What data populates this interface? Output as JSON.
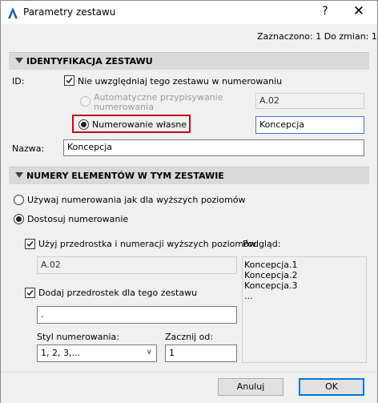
{
  "window": {
    "title": "Parametry zestawu",
    "help_label": "?",
    "close_label": "✕",
    "icon": "archicad-logo-icon"
  },
  "status": "Zaznaczono: 1 Do zmian: 1",
  "identification": {
    "header": "IDENTYFIKACJA ZESTAWU",
    "id_label": "ID:",
    "exclude_checkbox": {
      "label": "Nie uwzględniaj tego zestawu w numerowaniu",
      "checked": true
    },
    "auto_radio": {
      "label_line1": "Automatyczne przypisywanie",
      "label_line2": "numerowania",
      "checked": false,
      "enabled": false
    },
    "auto_value": "A.02",
    "custom_radio": {
      "label": "Numerowanie własne",
      "checked": true
    },
    "custom_value": "Koncepcja",
    "name_label": "Nazwa:",
    "name_value": "Koncepcja"
  },
  "numbering": {
    "header": "NUMERY ELEMENTÓW W TYM ZESTAWIE",
    "radio_parent": {
      "label": "Używaj numerowania jak dla wyższych poziomów",
      "checked": false
    },
    "radio_adjust": {
      "label": "Dostosuj numerowanie",
      "checked": true
    },
    "use_prefix": {
      "label": "Użyj przedrostka i numeracji wyższych poziomów",
      "checked": true
    },
    "use_prefix_value": "A.02",
    "add_prefix": {
      "label": "Dodaj przedrostek dla tego zestawu",
      "checked": true
    },
    "add_prefix_value": ".",
    "style_label": "Styl numerowania:",
    "style_value": "1, 2, 3,...",
    "start_label": "Zacznij od:",
    "start_value": "1",
    "preview_label": "Podgląd:",
    "preview_lines": [
      "Koncepcja.1",
      "Koncepcja.2",
      "Koncepcja.3",
      "..."
    ]
  },
  "buttons": {
    "cancel": "Anuluj",
    "ok": "OK"
  },
  "colors": {
    "highlight": "#b5121b",
    "focus": "#3c78c8",
    "default_button": "#0078d7"
  }
}
